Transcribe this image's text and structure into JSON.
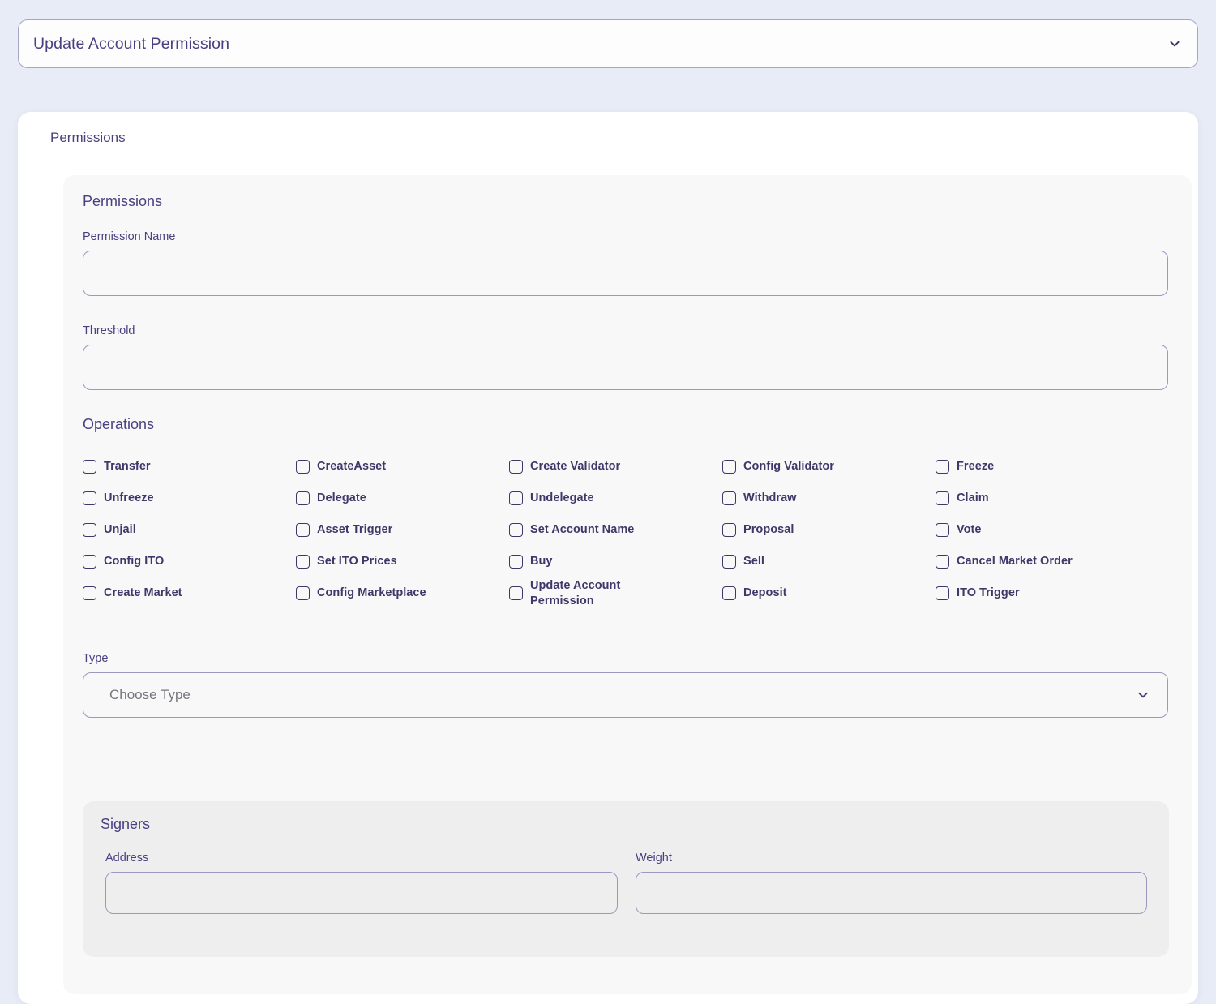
{
  "header": {
    "title": "Update Account Permission",
    "chevron_icon": "chevron-down-icon"
  },
  "card": {
    "title": "Permissions"
  },
  "permissions": {
    "panel_title": "Permissions",
    "permission_name": {
      "label": "Permission Name",
      "value": "",
      "placeholder": ""
    },
    "threshold": {
      "label": "Threshold",
      "value": "",
      "placeholder": ""
    },
    "operations": {
      "title": "Operations",
      "items": [
        {
          "label": "Transfer",
          "checked": false
        },
        {
          "label": "CreateAsset",
          "checked": false
        },
        {
          "label": "Create Validator",
          "checked": false
        },
        {
          "label": "Config Validator",
          "checked": false
        },
        {
          "label": "Freeze",
          "checked": false
        },
        {
          "label": "Unfreeze",
          "checked": false
        },
        {
          "label": "Delegate",
          "checked": false
        },
        {
          "label": "Undelegate",
          "checked": false
        },
        {
          "label": "Withdraw",
          "checked": false
        },
        {
          "label": "Claim",
          "checked": false
        },
        {
          "label": "Unjail",
          "checked": false
        },
        {
          "label": "Asset Trigger",
          "checked": false
        },
        {
          "label": "Set Account Name",
          "checked": false
        },
        {
          "label": "Proposal",
          "checked": false
        },
        {
          "label": "Vote",
          "checked": false
        },
        {
          "label": "Config ITO",
          "checked": false
        },
        {
          "label": "Set ITO Prices",
          "checked": false
        },
        {
          "label": "Buy",
          "checked": false
        },
        {
          "label": "Sell",
          "checked": false
        },
        {
          "label": "Cancel Market Order",
          "checked": false
        },
        {
          "label": "Create Market",
          "checked": false
        },
        {
          "label": "Config Marketplace",
          "checked": false
        },
        {
          "label": "Update Account Permission",
          "checked": false
        },
        {
          "label": "Deposit",
          "checked": false
        },
        {
          "label": "ITO Trigger",
          "checked": false
        }
      ]
    },
    "type": {
      "label": "Type",
      "placeholder": "Choose Type",
      "selected": "",
      "chevron_icon": "chevron-down-icon"
    }
  },
  "signers": {
    "title": "Signers",
    "address": {
      "label": "Address",
      "value": "",
      "placeholder": ""
    },
    "weight": {
      "label": "Weight",
      "value": "",
      "placeholder": ""
    }
  },
  "colors": {
    "page_background": "#e8ecf6",
    "card_background": "#ffffff",
    "panel_background": "#f8f8f9",
    "signers_background": "#eeeeef",
    "text_primary": "#4a4080",
    "text_bold": "#3f3768",
    "border": "#9d98bd",
    "placeholder": "#77757f"
  }
}
